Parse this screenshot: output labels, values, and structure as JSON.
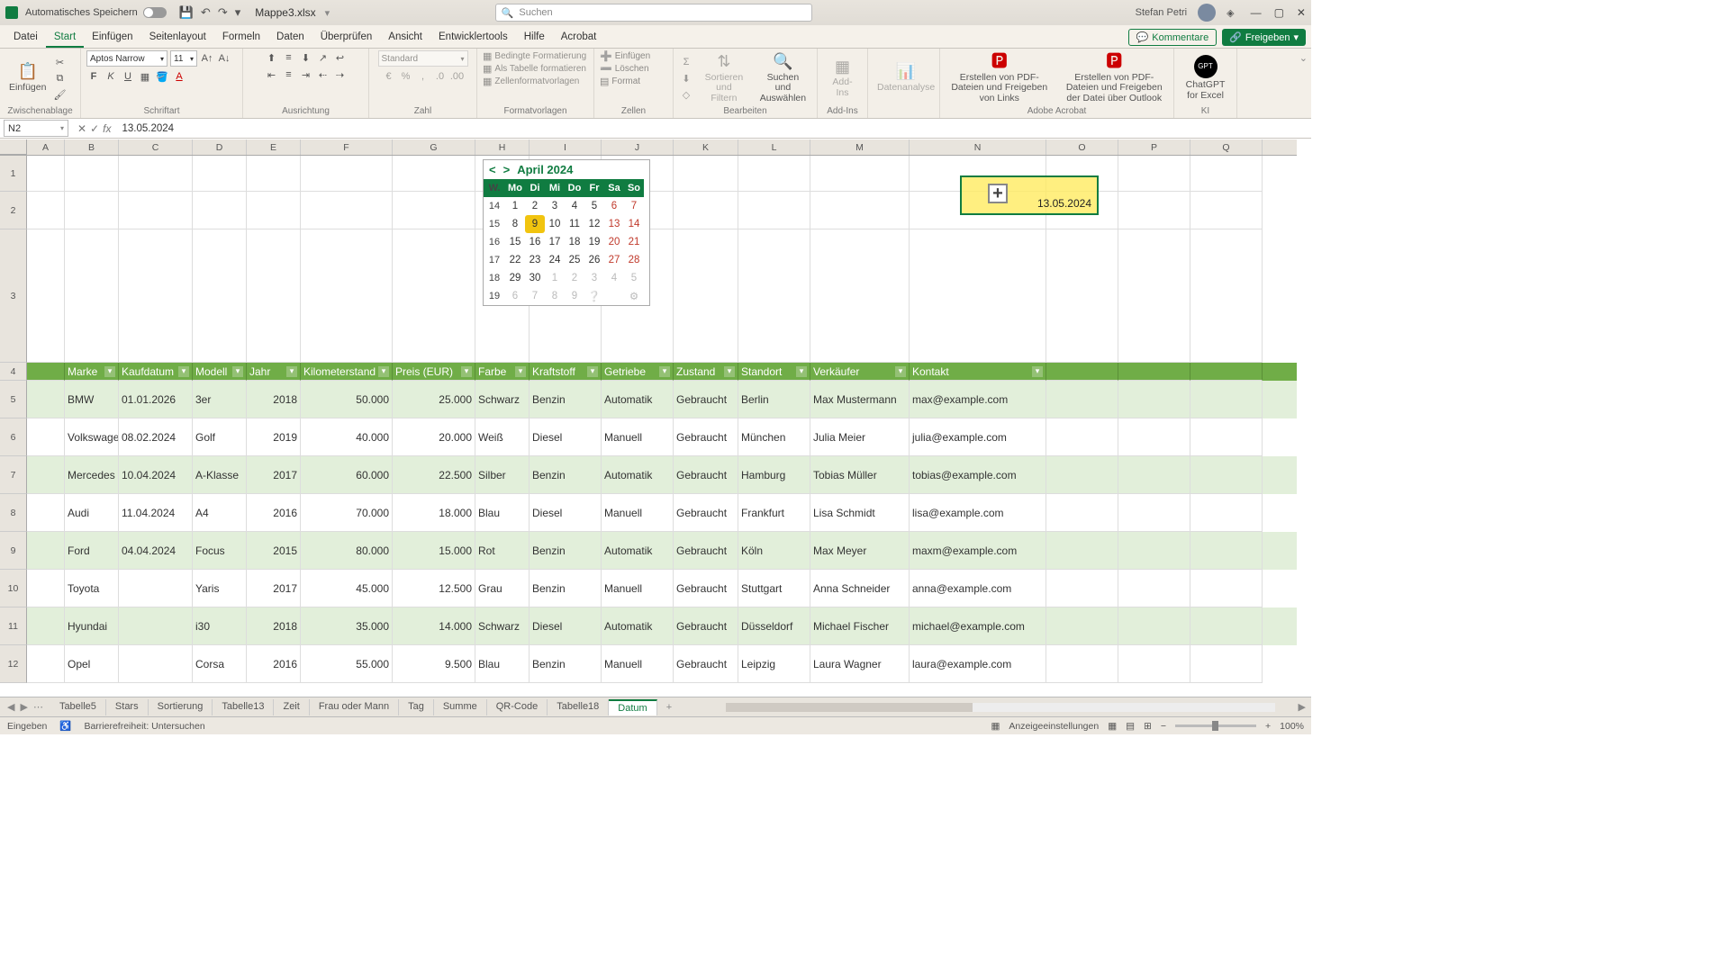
{
  "title": {
    "autosave": "Automatisches Speichern",
    "filename": "Mappe3.xlsx",
    "search": "Suchen",
    "user": "Stefan Petri"
  },
  "tabs": [
    "Datei",
    "Start",
    "Einfügen",
    "Seitenlayout",
    "Formeln",
    "Daten",
    "Überprüfen",
    "Ansicht",
    "Entwicklertools",
    "Hilfe",
    "Acrobat"
  ],
  "actions": {
    "comments": "Kommentare",
    "share": "Freigeben"
  },
  "ribbon": {
    "groups": [
      "Zwischenablage",
      "Schriftart",
      "Ausrichtung",
      "Zahl",
      "Formatvorlagen",
      "Zellen",
      "Bearbeiten",
      "Add-Ins",
      "Adobe Acrobat",
      "KI"
    ],
    "paste": "Einfügen",
    "font": "Aptos Narrow",
    "fontsize": "11",
    "numberFmt": "Standard",
    "condFmt": "Bedingte Formatierung",
    "asTable": "Als Tabelle formatieren",
    "cellStyle": "Zellenformatvorlagen",
    "insert": "Einfügen",
    "delete": "Löschen",
    "format": "Format",
    "sortFilter": "Sortieren und Filtern",
    "findSelect": "Suchen und Auswählen",
    "addins": "Add-Ins",
    "dataAnalysis": "Datenanalyse",
    "pdf1": "Erstellen von PDF-Dateien und Freigeben von Links",
    "pdf2": "Erstellen von PDF-Dateien und Freigeben der Datei über Outlook",
    "gpt": "ChatGPT for Excel"
  },
  "namebox": "N2",
  "formula": "13.05.2024",
  "cellEntry": "13.05.2024",
  "cols": [
    "A",
    "B",
    "C",
    "D",
    "E",
    "F",
    "G",
    "H",
    "I",
    "J",
    "K",
    "L",
    "M",
    "N",
    "O",
    "P",
    "Q"
  ],
  "calendar": {
    "title": "April 2024",
    "dow": [
      "W.",
      "Mo",
      "Di",
      "Mi",
      "Do",
      "Fr",
      "Sa",
      "So"
    ],
    "weeks": [
      {
        "w": "14",
        "d": [
          "1",
          "2",
          "3",
          "4",
          "5",
          "6",
          "7"
        ]
      },
      {
        "w": "15",
        "d": [
          "8",
          "9",
          "10",
          "11",
          "12",
          "13",
          "14"
        ]
      },
      {
        "w": "16",
        "d": [
          "15",
          "16",
          "17",
          "18",
          "19",
          "20",
          "21"
        ]
      },
      {
        "w": "17",
        "d": [
          "22",
          "23",
          "24",
          "25",
          "26",
          "27",
          "28"
        ]
      },
      {
        "w": "18",
        "d": [
          "29",
          "30",
          "1",
          "2",
          "3",
          "4",
          "5"
        ]
      },
      {
        "w": "19",
        "d": [
          "6",
          "7",
          "8",
          "9",
          "",
          "",
          " "
        ]
      }
    ]
  },
  "table": {
    "headers": [
      "Marke",
      "Kaufdatum",
      "Modell",
      "Jahr",
      "Kilometerstand",
      "Preis (EUR)",
      "Farbe",
      "Kraftstoff",
      "Getriebe",
      "Zustand",
      "Standort",
      "Verkäufer",
      "Kontakt"
    ],
    "rows": [
      [
        "BMW",
        "01.01.2026",
        "3er",
        "2018",
        "50.000",
        "25.000",
        "Schwarz",
        "Benzin",
        "Automatik",
        "Gebraucht",
        "Berlin",
        "Max Mustermann",
        "max@example.com"
      ],
      [
        "Volkswagen",
        "08.02.2024",
        "Golf",
        "2019",
        "40.000",
        "20.000",
        "Weiß",
        "Diesel",
        "Manuell",
        "Gebraucht",
        "München",
        "Julia Meier",
        "julia@example.com"
      ],
      [
        "Mercedes",
        "10.04.2024",
        "A-Klasse",
        "2017",
        "60.000",
        "22.500",
        "Silber",
        "Benzin",
        "Automatik",
        "Gebraucht",
        "Hamburg",
        "Tobias Müller",
        "tobias@example.com"
      ],
      [
        "Audi",
        "11.04.2024",
        "A4",
        "2016",
        "70.000",
        "18.000",
        "Blau",
        "Diesel",
        "Manuell",
        "Gebraucht",
        "Frankfurt",
        "Lisa Schmidt",
        "lisa@example.com"
      ],
      [
        "Ford",
        "04.04.2024",
        "Focus",
        "2015",
        "80.000",
        "15.000",
        "Rot",
        "Benzin",
        "Automatik",
        "Gebraucht",
        "Köln",
        "Max Meyer",
        "maxm@example.com"
      ],
      [
        "Toyota",
        "",
        "Yaris",
        "2017",
        "45.000",
        "12.500",
        "Grau",
        "Benzin",
        "Manuell",
        "Gebraucht",
        "Stuttgart",
        "Anna Schneider",
        "anna@example.com"
      ],
      [
        "Hyundai",
        "",
        "i30",
        "2018",
        "35.000",
        "14.000",
        "Schwarz",
        "Diesel",
        "Automatik",
        "Gebraucht",
        "Düsseldorf",
        "Michael Fischer",
        "michael@example.com"
      ],
      [
        "Opel",
        "",
        "Corsa",
        "2016",
        "55.000",
        "9.500",
        "Blau",
        "Benzin",
        "Manuell",
        "Gebraucht",
        "Leipzig",
        "Laura Wagner",
        "laura@example.com"
      ]
    ]
  },
  "sheets": [
    "Tabelle5",
    "Stars",
    "Sortierung",
    "Tabelle13",
    "Zeit",
    "Frau oder Mann",
    "Tag",
    "Summe",
    "QR-Code",
    "Tabelle18",
    "Datum"
  ],
  "status": {
    "mode": "Eingeben",
    "access": "Barrierefreiheit: Untersuchen",
    "display": "Anzeigeeinstellungen",
    "zoom": "100%"
  }
}
